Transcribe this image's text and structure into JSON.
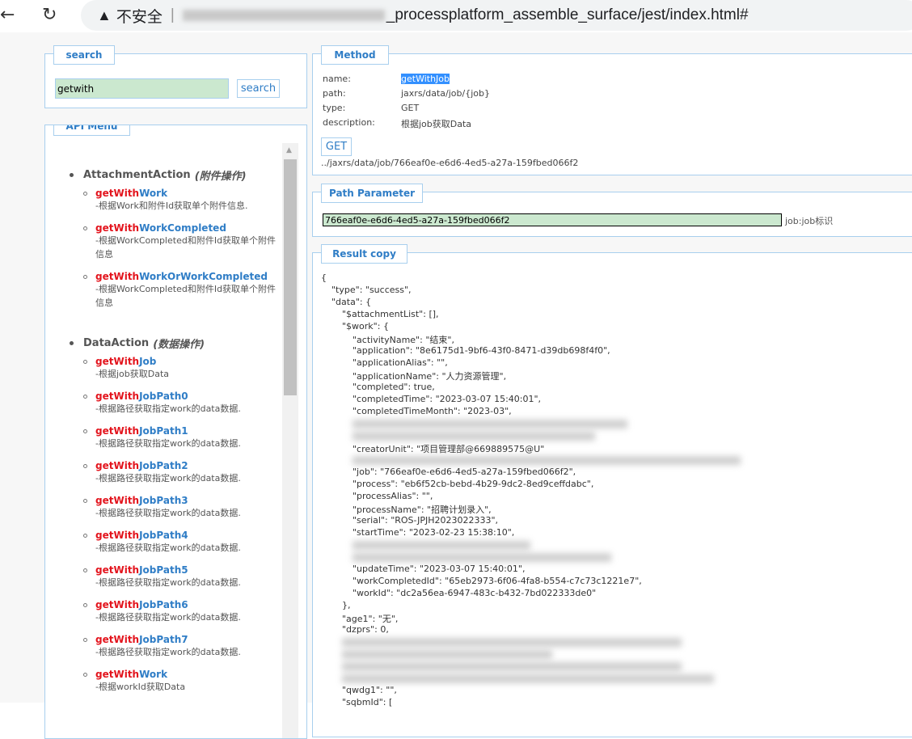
{
  "browser": {
    "security_label": "不安全",
    "url_suffix": "_processplatform_assemble_surface/jest/index.html#"
  },
  "search": {
    "legend": "search",
    "value": "getwith",
    "button": "search"
  },
  "menu": {
    "legend": "API Menu",
    "groups": [
      {
        "name": "AttachmentAction",
        "cn": "(附件操作)",
        "items": [
          {
            "hl": "getWith",
            "rest": "Work",
            "desc": "-根据Work和附件Id获取单个附件信息."
          },
          {
            "hl": "getWith",
            "rest": "WorkCompleted",
            "desc": "-根据WorkCompleted和附件Id获取单个附件信息"
          },
          {
            "hl": "getWith",
            "rest": "WorkOrWorkCompleted",
            "desc": "-根据WorkCompleted和附件Id获取单个附件信息"
          }
        ]
      },
      {
        "name": "DataAction",
        "cn": "(数据操作)",
        "items": [
          {
            "hl": "getWith",
            "rest": "Job",
            "desc": "-根据job获取Data"
          },
          {
            "hl": "getWith",
            "rest": "JobPath0",
            "desc": "-根据路径获取指定work的data数据."
          },
          {
            "hl": "getWith",
            "rest": "JobPath1",
            "desc": "-根据路径获取指定work的data数据."
          },
          {
            "hl": "getWith",
            "rest": "JobPath2",
            "desc": "-根据路径获取指定work的data数据."
          },
          {
            "hl": "getWith",
            "rest": "JobPath3",
            "desc": "-根据路径获取指定work的data数据."
          },
          {
            "hl": "getWith",
            "rest": "JobPath4",
            "desc": "-根据路径获取指定work的data数据."
          },
          {
            "hl": "getWith",
            "rest": "JobPath5",
            "desc": "-根据路径获取指定work的data数据."
          },
          {
            "hl": "getWith",
            "rest": "JobPath6",
            "desc": "-根据路径获取指定work的data数据."
          },
          {
            "hl": "getWith",
            "rest": "JobPath7",
            "desc": "-根据路径获取指定work的data数据."
          },
          {
            "hl": "getWith",
            "rest": "Work",
            "desc": "-根据workId获取Data"
          }
        ]
      }
    ]
  },
  "method": {
    "legend": "Method",
    "name_label": "name:",
    "name": "getWithJob",
    "path_label": "path:",
    "path": "jaxrs/data/job/{job}",
    "type_label": "type:",
    "type": "GET",
    "desc_label": "description:",
    "desc": "根据job获取Data",
    "button": "GET",
    "url": "../jaxrs/data/job/766eaf0e-e6d6-4ed5-a27a-159fbed066f2"
  },
  "path_param": {
    "legend": "Path Parameter",
    "value": "766eaf0e-e6d6-4ed5-a27a-159fbed066f2",
    "desc": "job:job标识"
  },
  "result": {
    "legend": "Result copy",
    "lines": [
      {
        "i": 0,
        "t": "{"
      },
      {
        "i": 1,
        "t": "\"type\": \"success\","
      },
      {
        "i": 1,
        "t": "\"data\": {"
      },
      {
        "i": 2,
        "t": "\"$attachmentList\": [],"
      },
      {
        "i": 2,
        "t": "\"$work\": {"
      },
      {
        "i": 3,
        "t": "\"activityName\": \"结束\","
      },
      {
        "i": 3,
        "t": "\"application\": \"8e6175d1-9bf6-43f0-8471-d39db698f4f0\","
      },
      {
        "i": 3,
        "t": "\"applicationAlias\": \"\","
      },
      {
        "i": 3,
        "t": "\"applicationName\": \"人力资源管理\","
      },
      {
        "i": 3,
        "t": "\"completed\": true,"
      },
      {
        "i": 3,
        "t": "\"completedTime\": \"2023-03-07 15:40:01\","
      },
      {
        "i": 3,
        "t": "\"completedTimeMonth\": \"2023-03\","
      },
      {
        "i": 3,
        "r": true
      },
      {
        "i": 3,
        "r": true
      },
      {
        "i": 3,
        "t": "\"creatorUnit\": \"项目管理部@669889575@U\""
      },
      {
        "i": 3,
        "r": true
      },
      {
        "i": 3,
        "t": "\"job\": \"766eaf0e-e6d6-4ed5-a27a-159fbed066f2\","
      },
      {
        "i": 3,
        "t": "\"process\": \"eb6f52cb-bebd-4b29-9dc2-8ed9ceffdabc\","
      },
      {
        "i": 3,
        "t": "\"processAlias\": \"\","
      },
      {
        "i": 3,
        "t": "\"processName\": \"招聘计划录入\","
      },
      {
        "i": 3,
        "t": "\"serial\": \"ROS-JPJH2023022333\","
      },
      {
        "i": 3,
        "t": "\"startTime\": \"2023-02-23 15:38:10\","
      },
      {
        "i": 3,
        "r": true
      },
      {
        "i": 3,
        "r": true
      },
      {
        "i": 3,
        "t": "\"updateTime\": \"2023-03-07 15:40:01\","
      },
      {
        "i": 3,
        "t": "\"workCompletedId\": \"65eb2973-6f06-4fa8-b554-c7c73c1221e7\","
      },
      {
        "i": 3,
        "t": "\"workId\": \"dc2a56ea-6947-483c-b432-7bd022333de0\""
      },
      {
        "i": 2,
        "t": "},"
      },
      {
        "i": 2,
        "t": "\"age1\": \"无\","
      },
      {
        "i": 2,
        "t": "\"dzprs\": 0,"
      },
      {
        "i": 2,
        "r": true
      },
      {
        "i": 2,
        "r": true
      },
      {
        "i": 2,
        "r": true
      },
      {
        "i": 2,
        "r": true
      },
      {
        "i": 2,
        "t": "\"qwdg1\": \"\","
      },
      {
        "i": 2,
        "t": "\"sqbmId\": ["
      }
    ]
  }
}
